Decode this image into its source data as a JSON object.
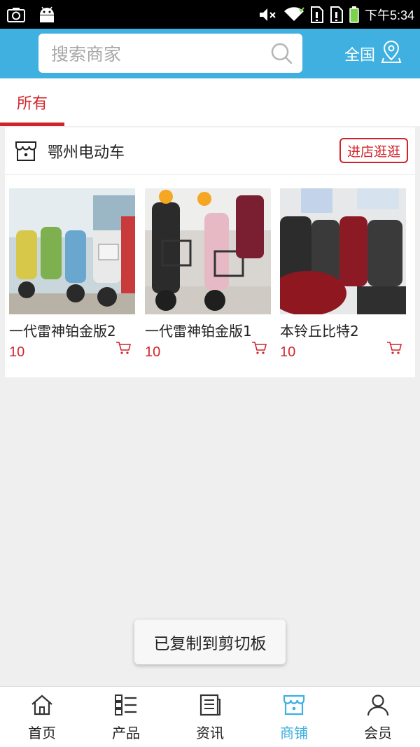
{
  "status_bar": {
    "time": "下午5:34",
    "icons": [
      "screenshot-icon",
      "android-icon",
      "mute-icon",
      "wifi-icon",
      "sim1-icon",
      "sim2-icon",
      "battery-icon"
    ],
    "battery_color": "#7bd34a"
  },
  "header": {
    "search_placeholder": "搜索商家",
    "region_label": "全国",
    "accent_color": "#3fb0df"
  },
  "tabs": [
    {
      "label": "所有",
      "active": true
    }
  ],
  "store": {
    "name": "鄂州电动车",
    "visit_button": "进店逛逛",
    "products": [
      {
        "title": "一代雷神铂金版2",
        "price": "10"
      },
      {
        "title": "一代雷神铂金版1",
        "price": "10"
      },
      {
        "title": "本铃丘比特2",
        "price": "10"
      }
    ]
  },
  "toast": {
    "text": "已复制到剪切板"
  },
  "bottom_nav": [
    {
      "label": "首页",
      "icon": "home-icon",
      "active": false
    },
    {
      "label": "产品",
      "icon": "list-icon",
      "active": false
    },
    {
      "label": "资讯",
      "icon": "news-icon",
      "active": false
    },
    {
      "label": "商铺",
      "icon": "shop-icon",
      "active": true
    },
    {
      "label": "会员",
      "icon": "user-icon",
      "active": false
    }
  ],
  "colors": {
    "red": "#d2232a",
    "blue": "#3fb0df"
  }
}
